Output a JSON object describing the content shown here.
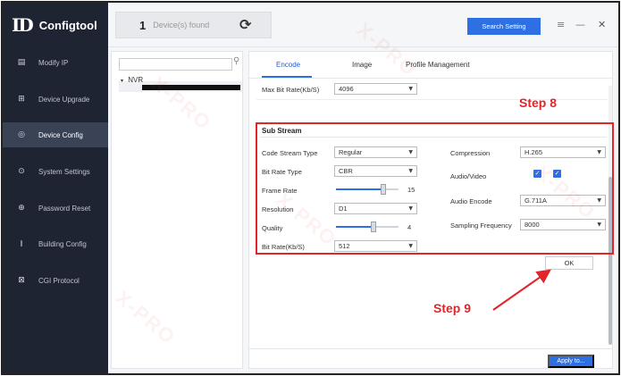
{
  "app": {
    "logo_mark": "ID",
    "title": "Configtool"
  },
  "sidebar": {
    "items": [
      {
        "label": "Modify IP",
        "icon": "modify-ip-icon",
        "glyph": "▤",
        "active": false
      },
      {
        "label": "Device Upgrade",
        "icon": "upgrade-icon",
        "glyph": "⊞",
        "active": false
      },
      {
        "label": "Device Config",
        "icon": "device-config-icon",
        "glyph": "◎",
        "active": true
      },
      {
        "label": "System Settings",
        "icon": "system-settings-icon",
        "glyph": "⊙",
        "active": false
      },
      {
        "label": "Password Reset",
        "icon": "lock-icon",
        "glyph": "⊕",
        "active": false
      },
      {
        "label": "Building Config",
        "icon": "building-icon",
        "glyph": "⫾",
        "active": false
      },
      {
        "label": "CGI Protocol",
        "icon": "cgi-protocol-icon",
        "glyph": "⊠",
        "active": false
      }
    ]
  },
  "header": {
    "device_count": "1",
    "device_label": "Device(s) found",
    "search_button": "Search Setting",
    "icons": {
      "refresh": "refresh-icon",
      "menu": "menu-icon",
      "minimize": "minimize-icon",
      "close": "close-icon"
    },
    "glyphs": {
      "refresh": "⟳",
      "menu": "≡",
      "minimize": "—",
      "close": "✕"
    }
  },
  "tree": {
    "search_placeholder": "",
    "search_icon_glyph": "⚲",
    "root_label": "NVR",
    "caret": "▾"
  },
  "tabs": [
    {
      "label": "Encode",
      "active": true
    },
    {
      "label": "Image",
      "active": false
    },
    {
      "label": "Profile Management",
      "active": false
    }
  ],
  "main_stream": {
    "max_bit_rate_label": "Max Bit Rate(Kb/S)",
    "max_bit_rate_value": "4096"
  },
  "sub_stream": {
    "title": "Sub Stream",
    "code_stream_type_label": "Code Stream Type",
    "code_stream_type_value": "Regular",
    "bit_rate_type_label": "Bit Rate Type",
    "bit_rate_type_value": "CBR",
    "frame_rate_label": "Frame Rate",
    "frame_rate_value": "15",
    "frame_rate_fraction": 0.76,
    "resolution_label": "Resolution",
    "resolution_value": "D1",
    "quality_label": "Quality",
    "quality_value": "4",
    "quality_fraction": 0.6,
    "bit_rate_label": "Bit Rate(Kb/S)",
    "bit_rate_value": "512",
    "compression_label": "Compression",
    "compression_value": "H.265",
    "audio_video_label": "Audio/Video",
    "audio_video_checked": [
      true,
      true
    ],
    "audio_encode_label": "Audio Encode",
    "audio_encode_value": "G.711A",
    "sampling_frequency_label": "Sampling Frequency",
    "sampling_frequency_value": "8000"
  },
  "buttons": {
    "ok": "OK",
    "apply": "Apply to..."
  },
  "annotations": {
    "step8": "Step 8",
    "step9": "Step 9",
    "color": "#e1252b"
  },
  "watermark": "X-PRO"
}
